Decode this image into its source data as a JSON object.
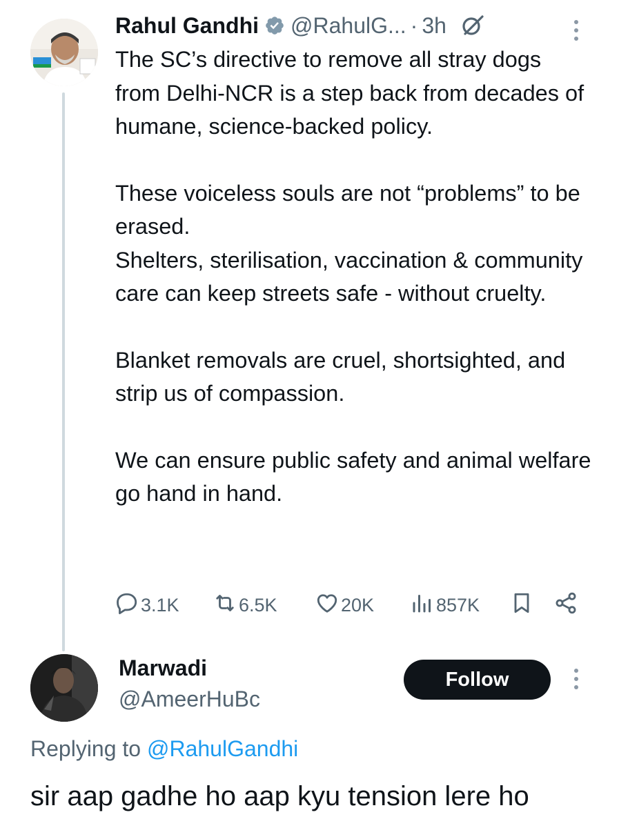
{
  "tweet": {
    "author_name": "Rahul Gandhi",
    "author_handle": "@RahulG...",
    "separator": "·",
    "time": "3h",
    "paragraphs": [
      "The SC’s directive to remove all stray dogs from Delhi-NCR is a step back from decades of humane, science-backed policy.",
      "These voiceless souls are not “problems” to be erased.",
      "Shelters, sterilisation, vaccination & community care can keep streets safe - without cruelty.",
      "Blanket removals are cruel, shortsighted, and strip us of compassion.",
      "We can ensure public safety and animal welfare go hand in hand."
    ],
    "actions": {
      "replies": "3.1K",
      "reposts": "6.5K",
      "likes": "20K",
      "views": "857K"
    }
  },
  "reply": {
    "author_name": "Marwadi",
    "author_handle": "@AmeerHuBc",
    "follow_label": "Follow",
    "replying_prefix": "Replying to ",
    "replying_to": "@RahulGandhi",
    "text": "sir aap gadhe ho aap kyu tension lere ho"
  },
  "icons": {
    "verified": "verified-badge-icon",
    "grok": "grok-icon",
    "more": "more-vertical-icon",
    "reply": "reply-icon",
    "repost": "repost-icon",
    "like": "like-icon",
    "views": "views-icon",
    "bookmark": "bookmark-icon",
    "share": "share-icon"
  },
  "colors": {
    "text": "#0f1419",
    "secondary": "#536471",
    "link": "#1d9bf0",
    "follow_bg": "#0f1419",
    "thread_line": "#cfd9de"
  }
}
